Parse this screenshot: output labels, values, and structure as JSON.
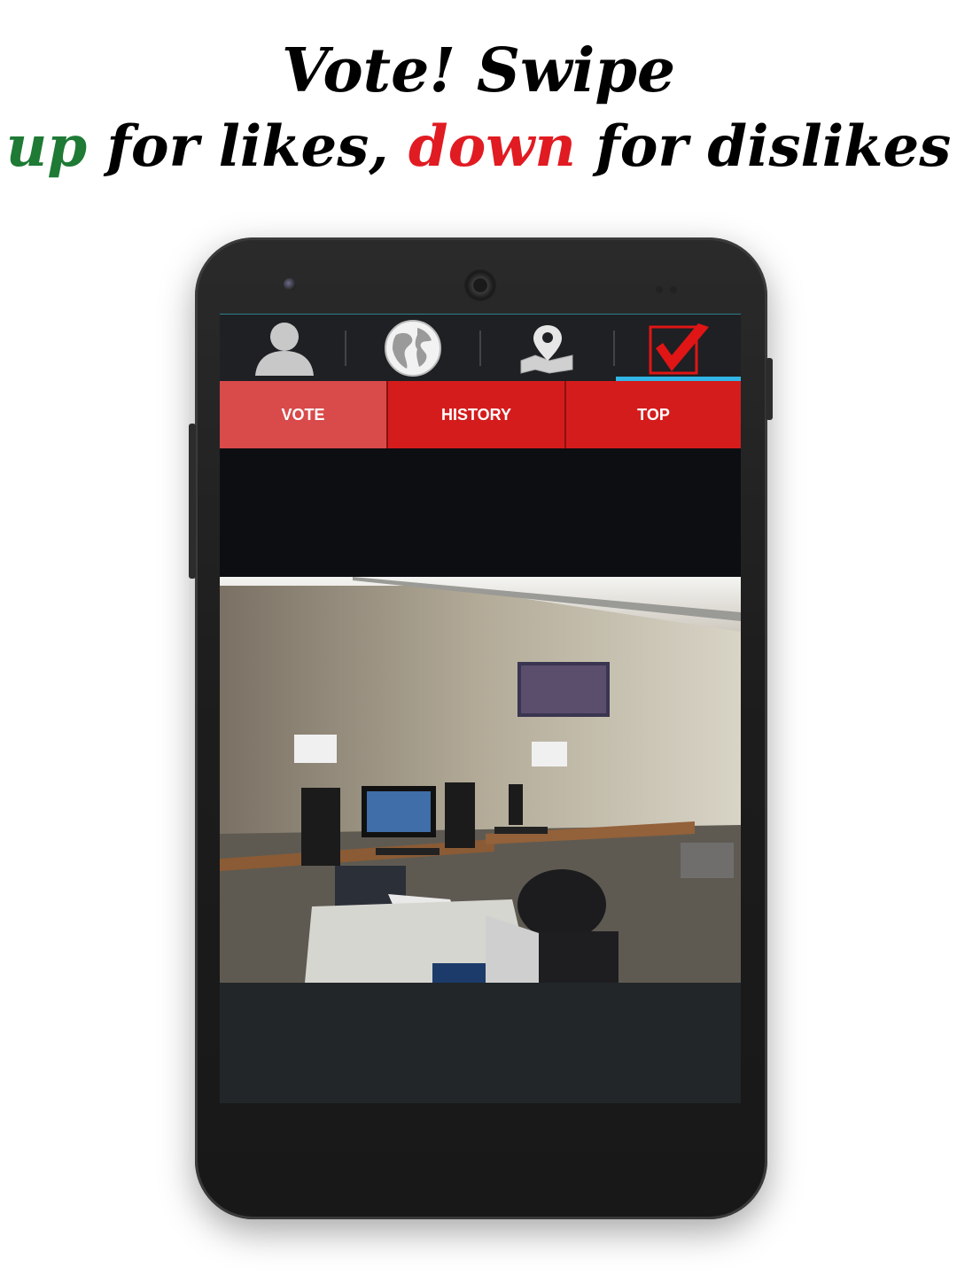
{
  "headline": {
    "line1": "Vote!  Swipe",
    "up": "up",
    "for_likes": " for likes, ",
    "down": "down",
    "for_dislikes": " for dislikes"
  },
  "topnav": {
    "icons": [
      "profile-icon",
      "globe-icon",
      "location-map-icon",
      "vote-check-icon"
    ],
    "active_index": 3
  },
  "tabs": [
    {
      "label": "VOTE",
      "active": true
    },
    {
      "label": "HISTORY",
      "active": false
    },
    {
      "label": "TOP",
      "active": false
    }
  ],
  "colors": {
    "tab_red": "#d41c1c",
    "tab_active": "#d94a4a",
    "indicator_blue": "#33b5e5",
    "like_green": "#1e7a35",
    "dislike_red": "#e11b22"
  }
}
